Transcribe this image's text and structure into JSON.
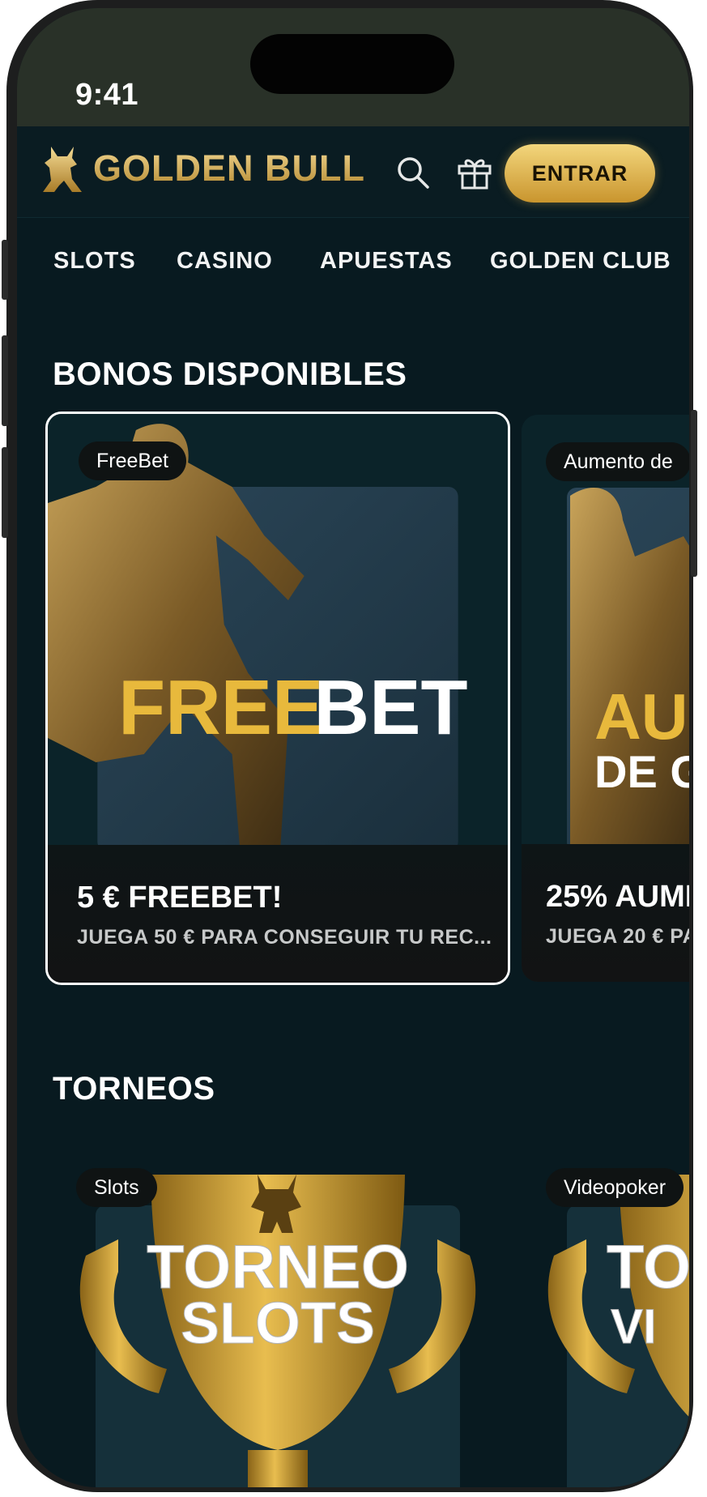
{
  "status": {
    "time": "9:41"
  },
  "header": {
    "logo_text": "GOLDEN BULL",
    "login_label": "ENTRAR"
  },
  "nav": {
    "items": [
      "SLOTS",
      "CASINO",
      "APUESTAS",
      "GOLDEN CLUB"
    ]
  },
  "bonuses": {
    "title": "BONOS DISPONIBLES",
    "cards": [
      {
        "tag": "FreeBet",
        "art_word_gold": "FREE",
        "art_word_white": "BET",
        "title": "5 € FREEBET!",
        "subtitle": "JUEGA 50 € PARA CONSEGUIR TU REC..."
      },
      {
        "tag": "Aumento de",
        "art_word_gold": "AU",
        "art_word_white": "DE G",
        "title": "25% AUMI",
        "subtitle": "JUEGA 20 € PA"
      }
    ]
  },
  "tournaments": {
    "title": "TORNEOS",
    "cards": [
      {
        "tag": "Slots",
        "art_line1": "TORNEO",
        "art_line2": "SLOTS"
      },
      {
        "tag": "Videopoker",
        "art_line1": "TO",
        "art_line2": "VI"
      }
    ]
  },
  "colors": {
    "background": "#081a20",
    "gold": "#e8b93c",
    "button_gold": "#e0b04a"
  }
}
